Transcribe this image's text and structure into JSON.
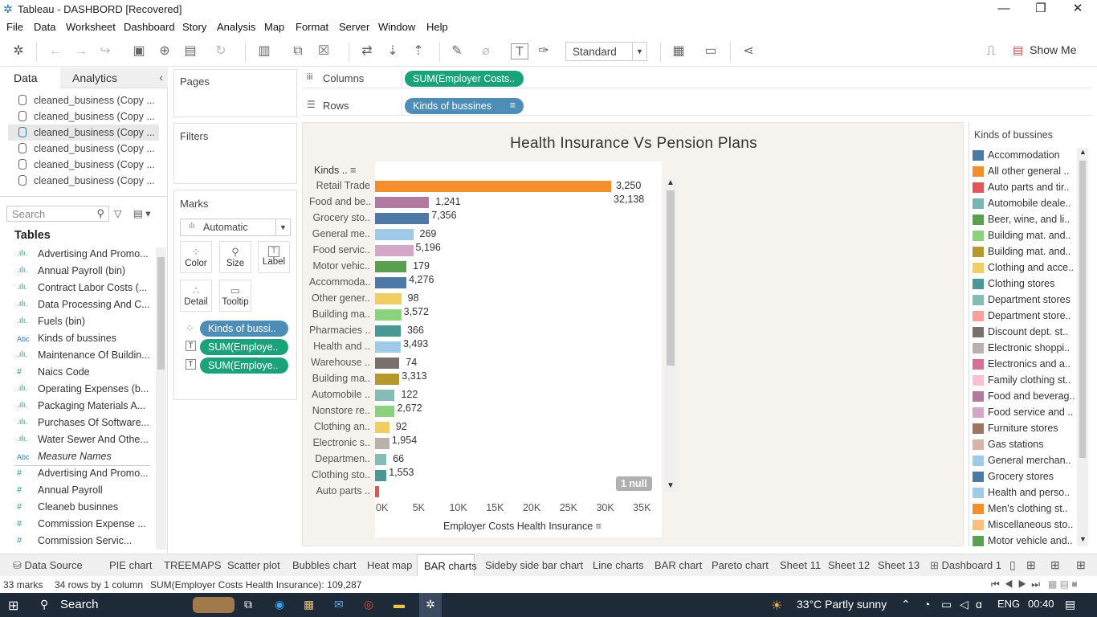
{
  "window": {
    "title": "Tableau - DASHBORD [Recovered]"
  },
  "menu": [
    "File",
    "Data",
    "Worksheet",
    "Dashboard",
    "Story",
    "Analysis",
    "Map",
    "Format",
    "Server",
    "Window",
    "Help"
  ],
  "toolbar": {
    "fit_mode": "Standard",
    "show_me": "Show Me"
  },
  "left_pane": {
    "tab_data": "Data",
    "tab_analytics": "Analytics",
    "datasources": [
      "cleaned_business (Copy ...",
      "cleaned_business (Copy ...",
      "cleaned_business (Copy ...",
      "cleaned_business (Copy ...",
      "cleaned_business (Copy ...",
      "cleaned_business (Copy ..."
    ],
    "search_placeholder": "Search",
    "tables_heading": "Tables",
    "fields": [
      {
        "icon": ".ılı.",
        "name": "Advertising And Promo..."
      },
      {
        "icon": ".ılı.",
        "name": "Annual Payroll (bin)"
      },
      {
        "icon": ".ılı.",
        "name": "Contract Labor Costs (..."
      },
      {
        "icon": ".ılı.",
        "name": "Data Processing And C..."
      },
      {
        "icon": ".ılı.",
        "name": "Fuels (bin)"
      },
      {
        "icon": "Abc",
        "name": "Kinds of bussines"
      },
      {
        "icon": ".ılı.",
        "name": "Maintenance Of Buildin..."
      },
      {
        "icon": "#",
        "name": "Naics Code"
      },
      {
        "icon": ".ılı.",
        "name": "Operating Expenses (b..."
      },
      {
        "icon": ".ılı.",
        "name": "Packaging Materials A..."
      },
      {
        "icon": ".ılı.",
        "name": "Purchases Of Software..."
      },
      {
        "icon": ".ılı.",
        "name": "Water Sewer And Othe..."
      },
      {
        "icon": "Abc",
        "name": "Measure Names"
      },
      {
        "icon": "#",
        "name": "Advertising And Promo..."
      },
      {
        "icon": "#",
        "name": "Annual Payroll"
      },
      {
        "icon": "#",
        "name": "Cleaneb businnes"
      },
      {
        "icon": "#",
        "name": "Commission Expense ..."
      },
      {
        "icon": "#",
        "name": "Commission Servic..."
      }
    ]
  },
  "cards": {
    "pages": "Pages",
    "filters": "Filters",
    "marks": "Marks",
    "mark_type": "Automatic",
    "mark_buttons": [
      "Color",
      "Size",
      "Label",
      "Detail",
      "Tooltip"
    ],
    "mark_pills": [
      "Kinds of bussi..",
      "SUM(Employe..",
      "SUM(Employe.."
    ]
  },
  "shelves": {
    "columns_label": "Columns",
    "columns_pill": "SUM(Employer Costs..",
    "rows_label": "Rows",
    "rows_pill": "Kinds of bussines"
  },
  "chart_data": {
    "type": "bar",
    "title": "Health Insurance Vs Pension  Plans",
    "row_header": "Kinds ..",
    "xlabel": "Employer Costs Health Insurance",
    "xlim": [
      0,
      37000
    ],
    "x_ticks": [
      "0K",
      "5K",
      "10K",
      "15K",
      "20K",
      "25K",
      "30K",
      "35K"
    ],
    "null_badge": "1 null",
    "categories": [
      "Retail Trade",
      "Food and be..",
      "Grocery sto..",
      "General me..",
      "Food servic..",
      "Motor vehic..",
      "Accommoda..",
      "Other gener..",
      "Building ma..",
      "Pharmacies ..",
      "Health and ..",
      "Warehouse ..",
      "Building ma..",
      "Automobile ..",
      "Nonstore re..",
      "Clothing an..",
      "Electronic s..",
      "Departmen..",
      "Clothing sto..",
      "Auto parts .."
    ],
    "values": [
      32138,
      7356,
      7356,
      5196,
      5196,
      4276,
      4276,
      3572,
      3572,
      3493,
      3493,
      3313,
      3313,
      2672,
      2672,
      1954,
      1954,
      1553,
      1553,
      600
    ],
    "colors": [
      "#f28e2b",
      "#b07aa1",
      "#4e79a7",
      "#a0cbe8",
      "#d4a6c8",
      "#59a14f",
      "#4e79a7",
      "#f1ce63",
      "#8cd17d",
      "#499894",
      "#a0cbe8",
      "#79706e",
      "#b6992d",
      "#86bcb6",
      "#8cd17d",
      "#f1ce63",
      "#bab0ac",
      "#86bcb6",
      "#499894",
      "#e15759"
    ],
    "labels": [
      {
        "after": 0,
        "top": "3,250",
        "bottom": "32,138"
      },
      {
        "after": 1,
        "top": "1,241",
        "bottom": "7,356"
      },
      {
        "after": 3,
        "top": "269",
        "bottom": "5,196"
      },
      {
        "after": 5,
        "top": "179",
        "bottom": "4,276"
      },
      {
        "after": 7,
        "top": "98",
        "bottom": "3,572"
      },
      {
        "after": 9,
        "top": "366",
        "bottom": "3,493"
      },
      {
        "after": 11,
        "top": "74",
        "bottom": "3,313"
      },
      {
        "after": 13,
        "top": "122",
        "bottom": "2,672"
      },
      {
        "after": 15,
        "top": "92",
        "bottom": "1,954"
      },
      {
        "after": 17,
        "top": "66",
        "bottom": "1,553"
      }
    ]
  },
  "legend": {
    "title": "Kinds of bussines",
    "items": [
      {
        "name": "Accommodation",
        "color": "#4e79a7"
      },
      {
        "name": "All other general ..",
        "color": "#f28e2b"
      },
      {
        "name": "Auto parts and tir..",
        "color": "#e15759"
      },
      {
        "name": "Automobile deale..",
        "color": "#76b7b2"
      },
      {
        "name": "Beer, wine, and li..",
        "color": "#59a14f"
      },
      {
        "name": "Building mat. and..",
        "color": "#8cd17d"
      },
      {
        "name": "Building mat. and..",
        "color": "#b6992d"
      },
      {
        "name": "Clothing and acce..",
        "color": "#f1ce63"
      },
      {
        "name": "Clothing stores",
        "color": "#499894"
      },
      {
        "name": "Department stores",
        "color": "#86bcb6"
      },
      {
        "name": "Department store..",
        "color": "#ff9d9a"
      },
      {
        "name": "Discount dept. st..",
        "color": "#79706e"
      },
      {
        "name": "Electronic shoppi..",
        "color": "#bab0ac"
      },
      {
        "name": "Electronics and a..",
        "color": "#d37295"
      },
      {
        "name": "Family clothing st..",
        "color": "#fabfd2"
      },
      {
        "name": "Food and beverag..",
        "color": "#b07aa1"
      },
      {
        "name": "Food service and ..",
        "color": "#d4a6c8"
      },
      {
        "name": "Furniture stores",
        "color": "#9d7660"
      },
      {
        "name": "Gas stations",
        "color": "#d7b5a6"
      },
      {
        "name": "General merchan..",
        "color": "#a0cbe8"
      },
      {
        "name": "Grocery stores",
        "color": "#4e79a7"
      },
      {
        "name": "Health and perso..",
        "color": "#a0cbe8"
      },
      {
        "name": "Men's clothing st..",
        "color": "#f28e2b"
      },
      {
        "name": "Miscellaneous sto..",
        "color": "#ffbe7d"
      },
      {
        "name": "Motor vehicle and..",
        "color": "#59a14f"
      }
    ]
  },
  "sheet_tabs": [
    "Data Source",
    "PIE chart",
    "TREEMAPS",
    "Scatter plot",
    "Bubbles chart",
    "Heat map",
    "BAR charts",
    "Sideby side bar chart",
    "Line charts",
    "BAR chart",
    "Pareto chart",
    "Sheet 11",
    "Sheet 12",
    "Sheet 13",
    "Dashboard 1"
  ],
  "active_sheet": "BAR charts",
  "status": {
    "marks": "33 marks",
    "dims": "34 rows by 1 column",
    "sum": "SUM(Employer Costs Health Insurance): 109,287"
  },
  "taskbar": {
    "search": "Search",
    "weather": "33°C  Partly sunny",
    "lang": "ENG",
    "time": "00:40"
  }
}
